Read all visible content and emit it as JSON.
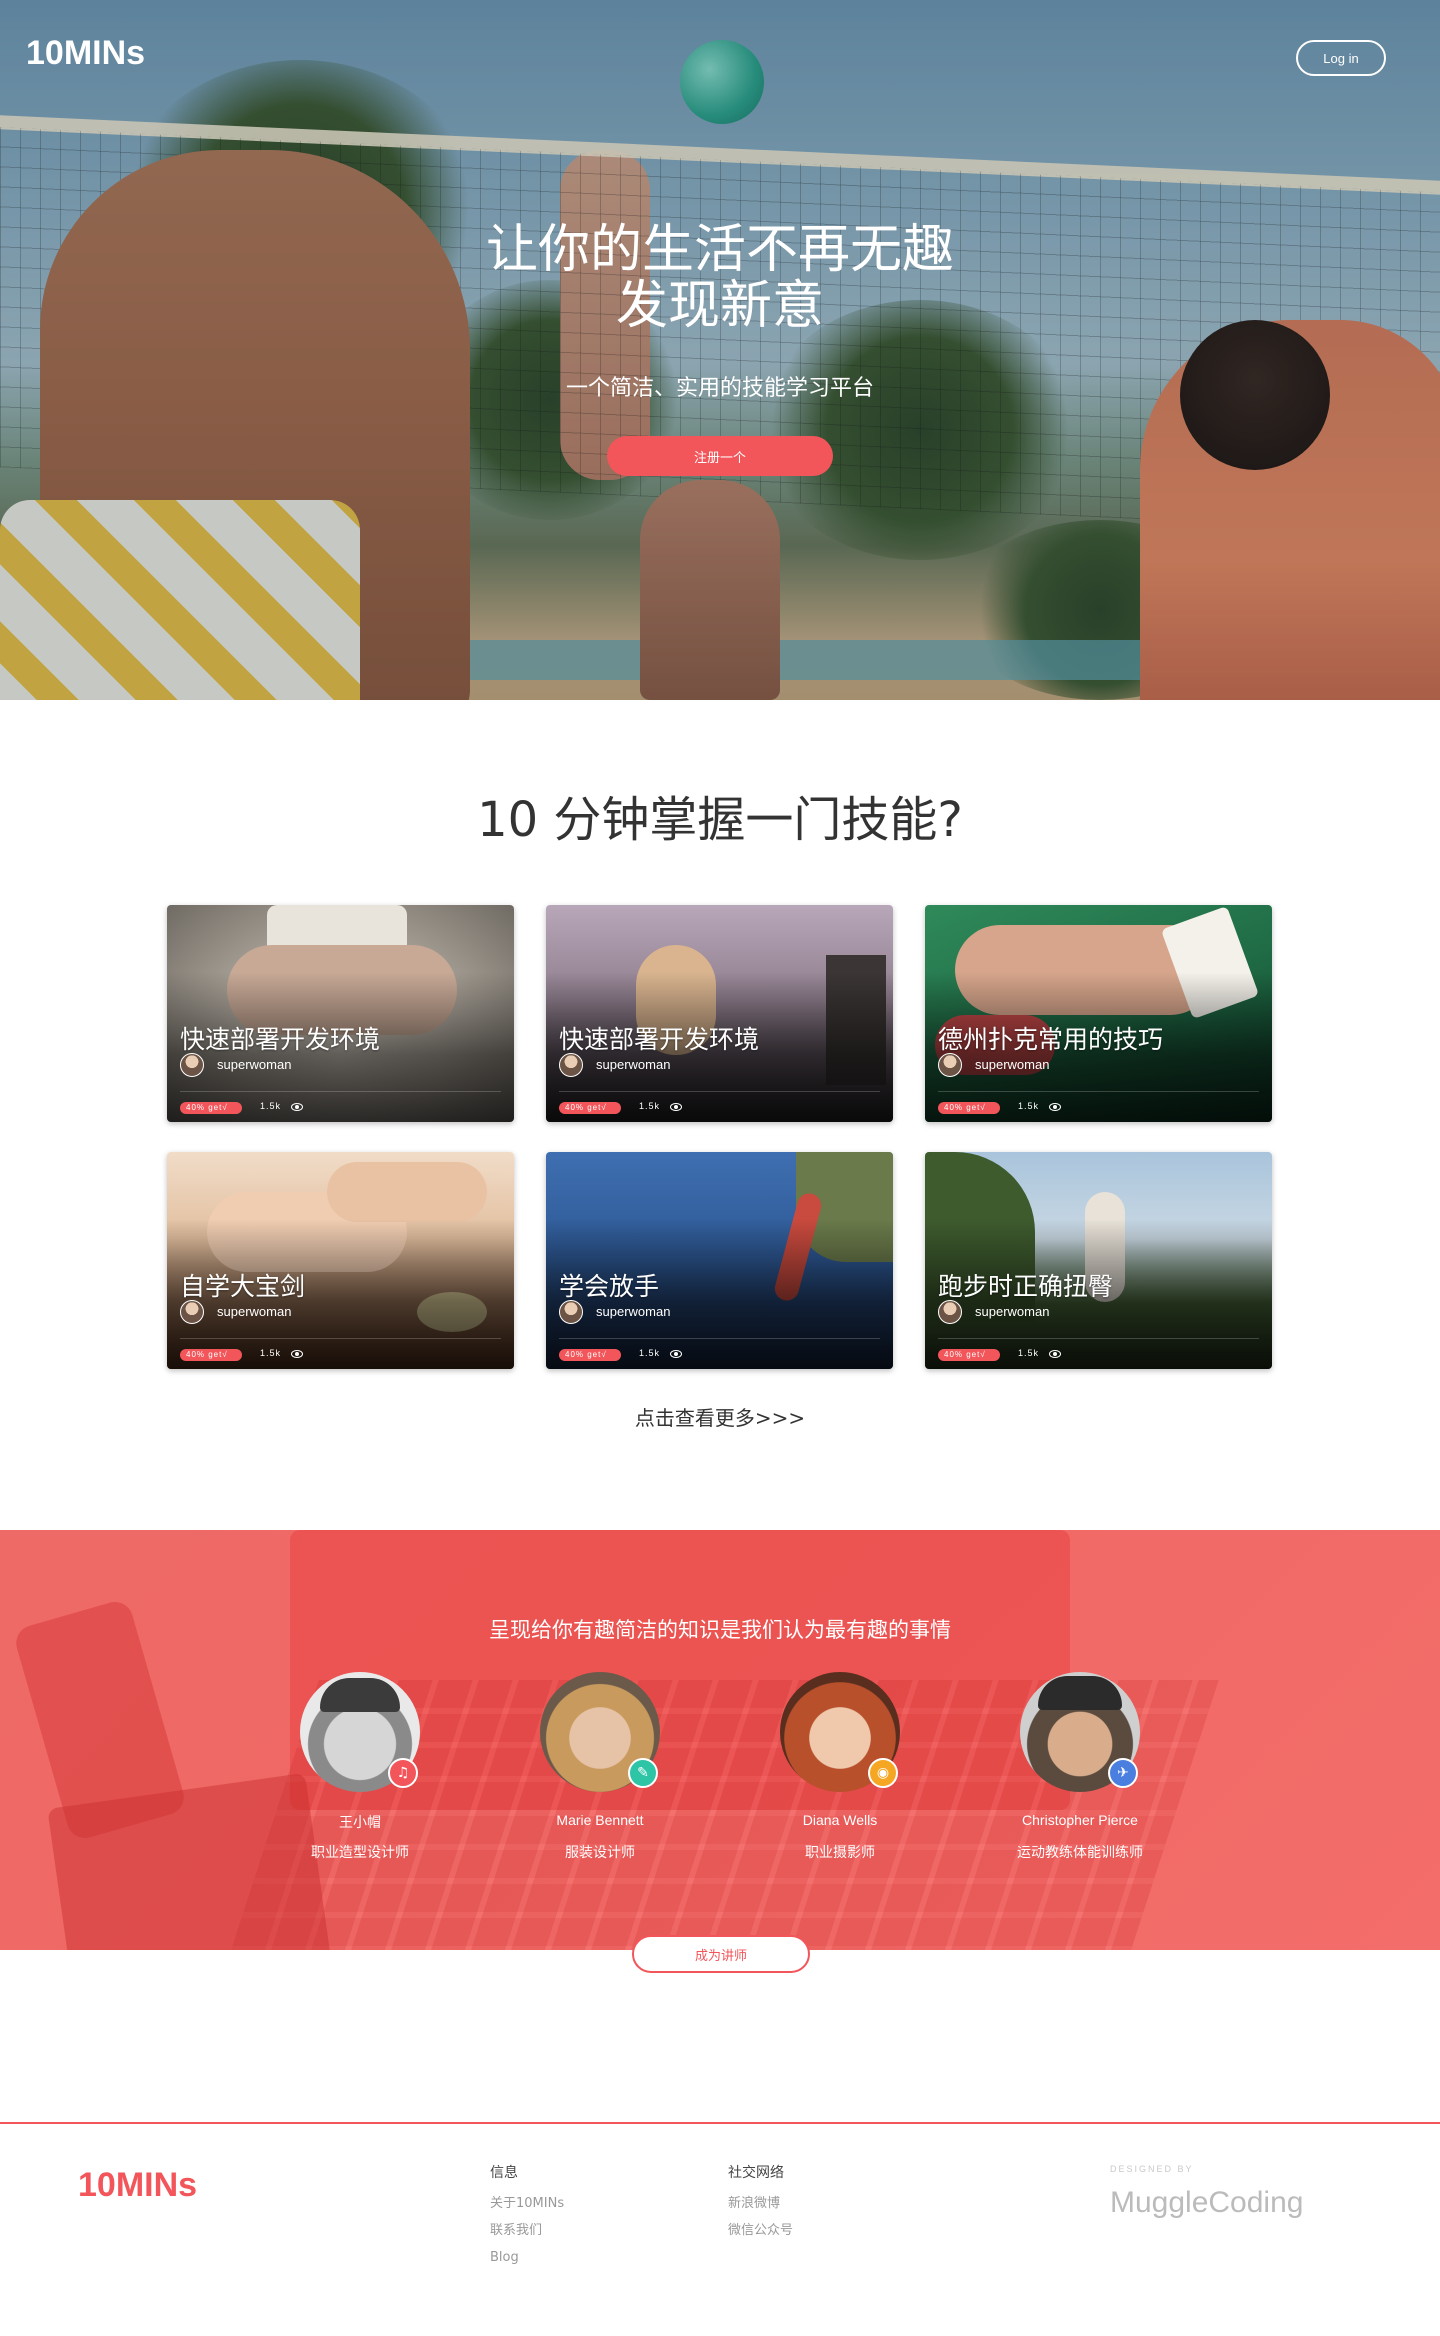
{
  "brand": {
    "logo": "10MINs",
    "accent_color": "#f2565a"
  },
  "header": {
    "login_label": "Log in"
  },
  "hero": {
    "title_line1": "让你的生活不再无趣",
    "title_line2": "发现新意",
    "subtitle": "一个简洁、实用的技能学习平台",
    "cta_label": "注册一个"
  },
  "skills": {
    "heading": "10 分钟掌握一门技能?",
    "more_link": "点击查看更多>>>",
    "cards": [
      {
        "title": "快速部署开发环境",
        "author": "superwoman",
        "progress": "40% get√",
        "views": "1.5k",
        "theme": "yoga"
      },
      {
        "title": "快速部署开发环境",
        "author": "superwoman",
        "progress": "40% get√",
        "views": "1.5k",
        "theme": "girl"
      },
      {
        "title": "德州扑克常用的技巧",
        "author": "superwoman",
        "progress": "40% get√",
        "views": "1.5k",
        "theme": "poker"
      },
      {
        "title": "自学大宝剑",
        "author": "superwoman",
        "progress": "40% get√",
        "views": "1.5k",
        "theme": "spa"
      },
      {
        "title": "学会放手",
        "author": "superwoman",
        "progress": "40% get√",
        "views": "1.5k",
        "theme": "climb"
      },
      {
        "title": "跑步时正确扭臀",
        "author": "superwoman",
        "progress": "40% get√",
        "views": "1.5k",
        "theme": "run"
      }
    ]
  },
  "teachers": {
    "heading": "呈现给你有趣简洁的知识是我们认为最有趣的事情",
    "become_label": "成为讲师",
    "list": [
      {
        "name": "王小帽",
        "role": "职业造型设计师",
        "badge_icon": "music-icon",
        "badge_glyph": "♫",
        "badge_color": "#f2565a"
      },
      {
        "name": "Marie Bennett",
        "role": "服装设计师",
        "badge_icon": "pencil-icon",
        "badge_glyph": "✎",
        "badge_color": "#2ec4a6"
      },
      {
        "name": "Diana Wells",
        "role": "职业摄影师",
        "badge_icon": "camera-icon",
        "badge_glyph": "◉",
        "badge_color": "#f5a623"
      },
      {
        "name": "Christopher Pierce",
        "role": "运动教练体能训练师",
        "badge_icon": "plane-icon",
        "badge_glyph": "✈",
        "badge_color": "#4a7fe0"
      }
    ]
  },
  "footer": {
    "logo": "10MINs",
    "info": {
      "heading": "信息",
      "items": [
        "关于10MINs",
        "联系我们",
        "Blog"
      ]
    },
    "social": {
      "heading": "社交网络",
      "items": [
        "新浪微博",
        "微信公众号"
      ]
    },
    "designed_by": "DESIGNED BY",
    "designer": "MuggleCoding"
  }
}
